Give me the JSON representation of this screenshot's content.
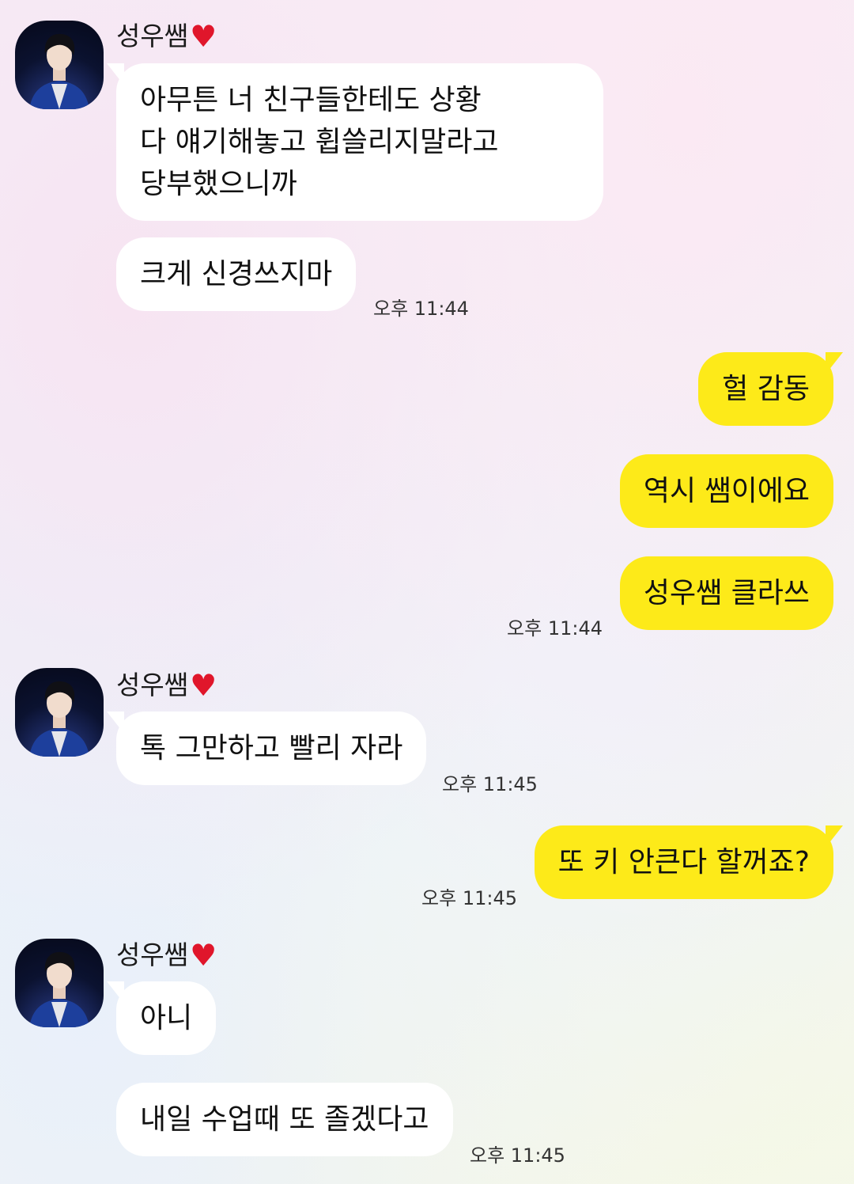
{
  "chat": {
    "groups": [
      {
        "sender": "성우쌤",
        "heart": "❤️",
        "avatar_icon": "profile-photo",
        "messages": [
          "아무튼 너 친구들한테도 상황\n다 얘기해놓고 휩쓸리지말라고\n당부했으니까",
          "크게 신경쓰지마"
        ],
        "time": "오후 11:44"
      },
      {
        "sender": "me",
        "messages": [
          "헐 감동",
          "역시 쌤이에요",
          "성우쌤 클라쓰"
        ],
        "time": "오후 11:44"
      },
      {
        "sender": "성우쌤",
        "heart": "❤️",
        "avatar_icon": "profile-photo",
        "messages": [
          "톡 그만하고 빨리 자라"
        ],
        "time": "오후 11:45"
      },
      {
        "sender": "me",
        "messages": [
          "또 키 안큰다 할꺼죠?"
        ],
        "time": "오후 11:45"
      },
      {
        "sender": "성우쌤",
        "heart": "❤️",
        "avatar_icon": "profile-photo",
        "messages": [
          "아니",
          "내일 수업때 또 졸겠다고"
        ],
        "time": "오후 11:45"
      }
    ]
  },
  "colors": {
    "outgoing_bubble": "#fdea19",
    "incoming_bubble": "#ffffff",
    "heart": "#e0162b"
  }
}
